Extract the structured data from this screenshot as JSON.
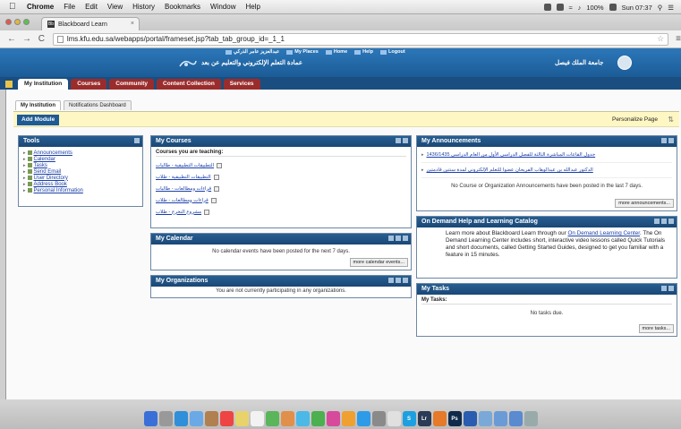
{
  "menubar": {
    "items": [
      "Chrome",
      "File",
      "Edit",
      "View",
      "History",
      "Bookmarks",
      "Window",
      "Help"
    ],
    "battery": "100%",
    "clock": "Sun 07:37"
  },
  "browser": {
    "tab_title": "Blackboard Learn",
    "url": "lms.kfu.edu.sa/webapps/portal/frameset.jsp?tab_tab_group_id=_1_1"
  },
  "header": {
    "user_name": "عبدالعزيز عامر الذركي",
    "links": [
      "My Places",
      "Home",
      "Help",
      "Logout"
    ],
    "deanship": "عمادة التعلم الإلكتروني والتعليم عن بعد",
    "university": "جامعة الملك فيصل"
  },
  "tabs": [
    "My Institution",
    "Courses",
    "Community",
    "Content Collection",
    "Services"
  ],
  "subtabs": [
    "My Institution",
    "Notifications Dashboard"
  ],
  "strip": {
    "add_module": "Add Module",
    "personalize": "Personalize Page"
  },
  "tools": {
    "title": "Tools",
    "items": [
      "Announcements",
      "Calendar",
      "Tasks",
      "Send Email",
      "User Directory",
      "Address Book",
      "Personal Information"
    ]
  },
  "my_courses": {
    "title": "My Courses",
    "subtitle": "Courses you are teaching:",
    "items": [
      "التطبيقات التطبيقية - طالبات",
      "التطبيقات التطبيقية - طلاب",
      "قراءات ومطالعات - طالبات",
      "قراءات ومطالعات - طلاب",
      "مشروع التخرج - طلاب"
    ]
  },
  "my_calendar": {
    "title": "My Calendar",
    "message": "No calendar events have been posted for the next 7 days.",
    "more": "more calendar events..."
  },
  "my_organizations": {
    "title": "My Organizations",
    "message": "You are not currently participating in any organizations."
  },
  "announcements": {
    "title": "My Announcements",
    "items": [
      "جدول القاعات المباشرة الثالثة للفصل الدراسي الأول من العام الدراسي 1436/1435",
      "الدكتور عبدالله بن عبدالوهاب الفريحان عضوا للتعلم الإلكتروني لمدة سنتين قادمتين"
    ],
    "message": "No Course or Organization Announcements have been posted in the last 7 days.",
    "more": "more announcements..."
  },
  "ondemand": {
    "title": "On Demand Help and Learning Catalog",
    "text_before_link1": "Learn more about Blackboard Learn through our ",
    "link1": "On Demand Learning Center",
    "text_after_link1": ". The On Demand Learning Center includes short, interactive video lessons called Quick Tutorials and short documents, called Getting Started Guides, designed to get you familiar with a feature in 15 minutes."
  },
  "my_tasks": {
    "title": "My Tasks",
    "subtitle": "My Tasks:",
    "message": "No tasks due.",
    "more": "more tasks..."
  },
  "colors": {
    "header_blue": "#1b5c97",
    "tab_red": "#9b2c2c",
    "strip_yellow": "#fff7c3"
  },
  "dock": {
    "icons": [
      "finder-icon",
      "launchpad-icon",
      "safari-icon",
      "mail-icon",
      "contacts-icon",
      "calendar-icon",
      "notes-icon",
      "reminders-icon",
      "maps-icon",
      "photos-icon",
      "messages-icon",
      "facetime-icon",
      "itunes-icon",
      "ibooks-icon",
      "app-store-icon",
      "preferences-icon",
      "chrome-icon",
      "skype-icon",
      "lightroom-icon",
      "firefox-icon",
      "photoshop-icon",
      "word-icon",
      "preview-icon",
      "folder-icon",
      "downloads-icon",
      "trash-icon"
    ],
    "labels": {
      "lightroom-icon": "Lr",
      "photoshop-icon": "Ps",
      "skype-icon": "S"
    }
  }
}
